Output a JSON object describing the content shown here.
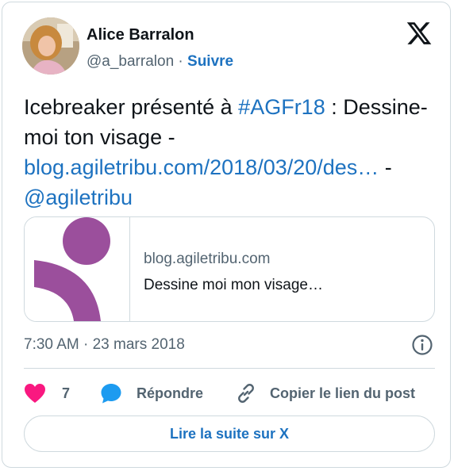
{
  "author": {
    "name": "Alice Barralon",
    "handle": "@a_barralon",
    "separator": "·",
    "follow_label": "Suivre"
  },
  "tweet": {
    "text_before": "Icebreaker présenté à ",
    "hashtag": "#AGFr18",
    "text_after_hashtag": " : Dessine-moi ton visage - ",
    "url": "blog.agiletribu.com/2018/03/20/des…",
    "text_dash": " - ",
    "mention": "@agiletribu"
  },
  "link_card": {
    "domain": "blog.agiletribu.com",
    "title": "Dessine moi mon visage…",
    "thumb_color": "#9b4f9c"
  },
  "timestamp": "7:30 AM · 23 mars 2018",
  "actions": {
    "like_count": "7",
    "reply_label": "Répondre",
    "copy_label": "Copier le lien du post"
  },
  "read_more_label": "Lire la suite sur X",
  "colors": {
    "link": "#1d72c0",
    "like": "#f91880",
    "reply": "#1d9bf0",
    "text": "#0f1419",
    "muted": "#536471"
  }
}
